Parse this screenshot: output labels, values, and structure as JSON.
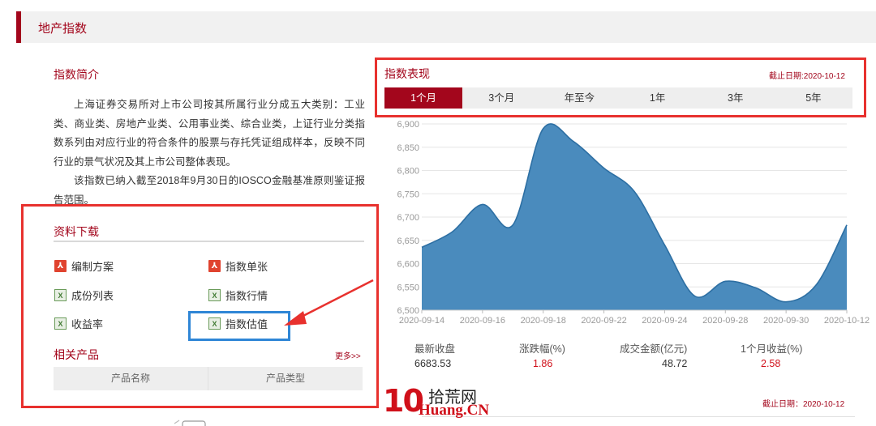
{
  "section": {
    "title": "地产指数"
  },
  "intro": {
    "title": "指数简介",
    "paragraphs": [
      "上海证券交易所对上市公司按其所属行业分成五大类别：工业类、商业类、房地产业类、公用事业类、综合业类，上证行业分类指数系列由对应行业的符合条件的股票与存托凭证组成样本，反映不同行业的景气状况及其上市公司整体表现。",
      "该指数已纳入截至2018年9月30日的IOSCO金融基准原则鉴证报告范围。"
    ]
  },
  "downloads": {
    "title": "资料下载",
    "items": [
      {
        "label": "编制方案",
        "icon": "pdf-icon"
      },
      {
        "label": "指数单张",
        "icon": "pdf-icon"
      },
      {
        "label": "成份列表",
        "icon": "excel-icon"
      },
      {
        "label": "指数行情",
        "icon": "excel-icon"
      },
      {
        "label": "收益率",
        "icon": "excel-icon"
      },
      {
        "label": "指数估值",
        "icon": "excel-icon"
      }
    ]
  },
  "related": {
    "title": "相关产品",
    "more": "更多>>",
    "columns": [
      "产品名称",
      "产品类型"
    ]
  },
  "performance": {
    "title": "指数表现",
    "date": "截止日期:2020-10-12",
    "tabs": [
      "1个月",
      "3个月",
      "年至今",
      "1年",
      "3年",
      "5年"
    ],
    "active_tab": 0
  },
  "stats": {
    "headers": [
      "最新收盘",
      "涨跌幅(%)",
      "成交金额(亿元)",
      "1个月收益(%)"
    ],
    "values": [
      "6683.53",
      "1.86",
      "48.72",
      "2.58"
    ]
  },
  "footer": {
    "date": "截止日期：2020-10-12"
  },
  "watermark": {
    "number": "10",
    "cn": "拾荒网",
    "en": "Huang.CN"
  },
  "colors": {
    "brand": "#a3061c",
    "area_fill": "#4a8bbd",
    "area_stroke": "#2d6fa3",
    "annotation_red": "#e8312e",
    "annotation_blue": "#2f86d6"
  },
  "chart_data": {
    "type": "area",
    "x": [
      "2020-09-14",
      "2020-09-15",
      "2020-09-16",
      "2020-09-17",
      "2020-09-18",
      "2020-09-21",
      "2020-09-22",
      "2020-09-23",
      "2020-09-24",
      "2020-09-25",
      "2020-09-28",
      "2020-09-29",
      "2020-09-30",
      "2020-10-09",
      "2020-10-12"
    ],
    "values": [
      6635,
      6668,
      6727,
      6683,
      6890,
      6862,
      6805,
      6755,
      6640,
      6530,
      6562,
      6548,
      6518,
      6555,
      6683
    ],
    "xticks": [
      "2020-09-14",
      "2020-09-16",
      "2020-09-18",
      "2020-09-22",
      "2020-09-24",
      "2020-09-28",
      "2020-09-30",
      "2020-10-12"
    ],
    "yticks": [
      "6,500",
      "6,550",
      "6,600",
      "6,650",
      "6,700",
      "6,750",
      "6,800",
      "6,850",
      "6,900"
    ],
    "ylim": [
      6500,
      6900
    ],
    "grid": true
  }
}
